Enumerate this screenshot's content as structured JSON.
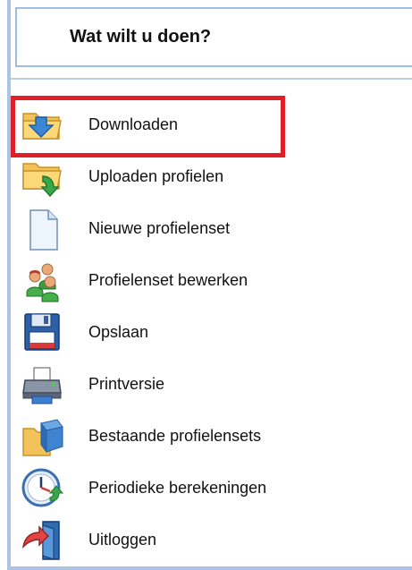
{
  "header": {
    "title": "Wat wilt u doen?"
  },
  "menu": {
    "items": [
      {
        "label": "Downloaden",
        "icon": "folder-download-icon"
      },
      {
        "label": "Uploaden profielen",
        "icon": "folder-upload-icon"
      },
      {
        "label": "Nieuwe profielenset",
        "icon": "new-document-icon"
      },
      {
        "label": "Profielenset bewerken",
        "icon": "users-group-icon"
      },
      {
        "label": "Opslaan",
        "icon": "floppy-disk-icon"
      },
      {
        "label": "Printversie",
        "icon": "printer-icon"
      },
      {
        "label": "Bestaande profielensets",
        "icon": "folder-box-icon"
      },
      {
        "label": "Periodieke berekeningen",
        "icon": "clock-icon"
      },
      {
        "label": "Uitloggen",
        "icon": "logout-door-icon"
      }
    ]
  },
  "colors": {
    "highlight": "#e01e27",
    "border": "#a9c4e6"
  }
}
